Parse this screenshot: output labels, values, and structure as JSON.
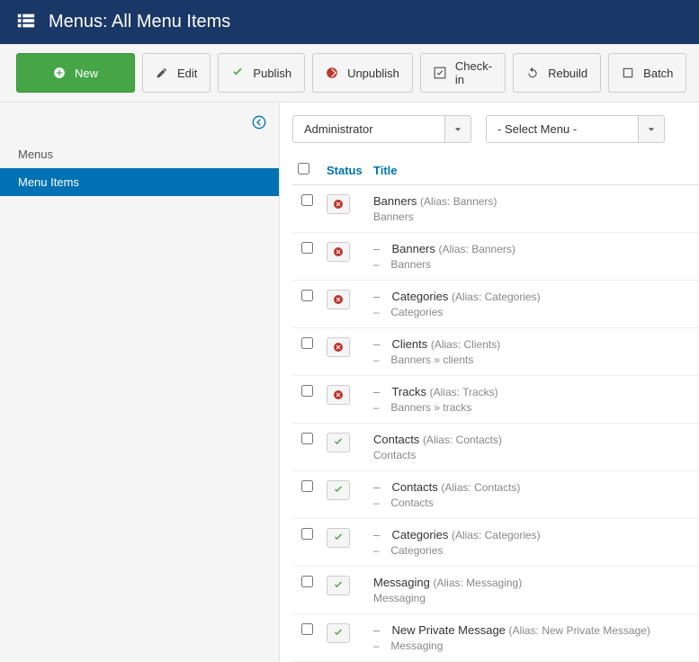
{
  "header": {
    "title": "Menus: All Menu Items"
  },
  "toolbar": {
    "new": "New",
    "edit": "Edit",
    "publish": "Publish",
    "unpublish": "Unpublish",
    "checkin": "Check-in",
    "rebuild": "Rebuild",
    "batch": "Batch"
  },
  "sidebar": {
    "items": [
      {
        "label": "Menus",
        "active": false
      },
      {
        "label": "Menu Items",
        "active": true
      }
    ]
  },
  "filters": {
    "client": "Administrator",
    "menu": "- Select Menu -"
  },
  "columns": {
    "status": "Status",
    "title": "Title"
  },
  "rows": [
    {
      "indent": 0,
      "status": "unpub",
      "title": "Banners",
      "alias": "Banners",
      "path": "Banners"
    },
    {
      "indent": 1,
      "status": "unpub",
      "title": "Banners",
      "alias": "Banners",
      "path": "Banners"
    },
    {
      "indent": 1,
      "status": "unpub",
      "title": "Categories",
      "alias": "Categories",
      "path": "Categories"
    },
    {
      "indent": 1,
      "status": "unpub",
      "title": "Clients",
      "alias": "Clients",
      "path": "Banners » clients"
    },
    {
      "indent": 1,
      "status": "unpub",
      "title": "Tracks",
      "alias": "Tracks",
      "path": "Banners » tracks"
    },
    {
      "indent": 0,
      "status": "pub",
      "title": "Contacts",
      "alias": "Contacts",
      "path": "Contacts"
    },
    {
      "indent": 1,
      "status": "pub",
      "title": "Contacts",
      "alias": "Contacts",
      "path": "Contacts"
    },
    {
      "indent": 1,
      "status": "pub",
      "title": "Categories",
      "alias": "Categories",
      "path": "Categories"
    },
    {
      "indent": 0,
      "status": "pub",
      "title": "Messaging",
      "alias": "Messaging",
      "path": "Messaging"
    },
    {
      "indent": 1,
      "status": "pub",
      "title": "New Private Message",
      "alias": "New Private Message",
      "path": "Messaging"
    }
  ]
}
